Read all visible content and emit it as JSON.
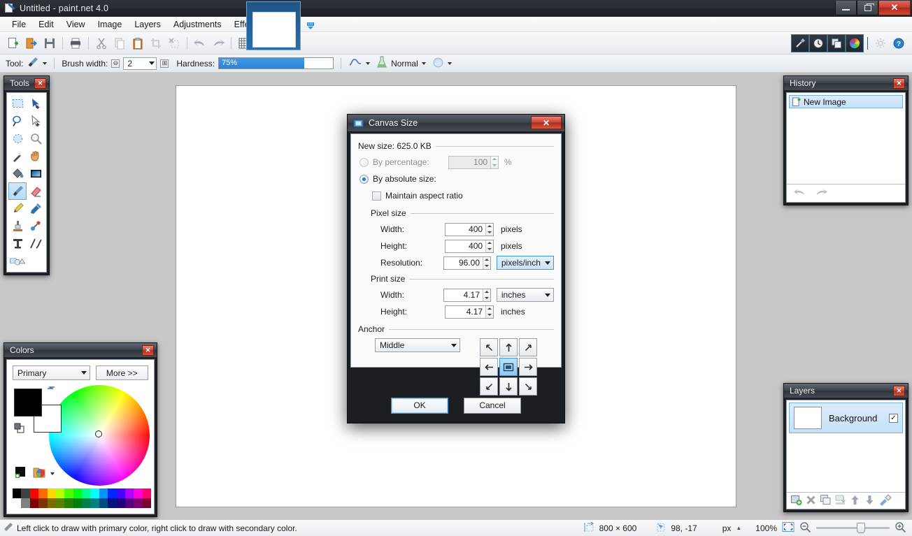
{
  "window": {
    "title": "Untitled - paint.net 4.0",
    "icon": "paintnet-icon",
    "minimize_label": "",
    "maximize_label": "",
    "close_label": "✕"
  },
  "menubar": {
    "items": [
      {
        "label": "File"
      },
      {
        "label": "Edit"
      },
      {
        "label": "View"
      },
      {
        "label": "Image"
      },
      {
        "label": "Layers"
      },
      {
        "label": "Adjustments"
      },
      {
        "label": "Effects"
      }
    ]
  },
  "toolbar": {
    "buttons": [
      {
        "name": "new-icon"
      },
      {
        "name": "open-icon"
      },
      {
        "name": "save-icon"
      },
      {
        "name": "print-icon"
      },
      {
        "name": "cut-icon"
      },
      {
        "name": "copy-icon"
      },
      {
        "name": "paste-icon"
      },
      {
        "name": "crop-to-selection-icon"
      },
      {
        "name": "deselect-icon"
      },
      {
        "name": "undo-icon"
      },
      {
        "name": "redo-icon"
      },
      {
        "name": "grid-icon"
      },
      {
        "name": "rulers-icon"
      }
    ],
    "right_buttons": [
      {
        "name": "tools-window-icon"
      },
      {
        "name": "history-window-icon"
      },
      {
        "name": "layers-window-icon"
      },
      {
        "name": "colors-window-icon"
      },
      {
        "name": "settings-icon"
      },
      {
        "name": "help-icon"
      }
    ]
  },
  "options_bar": {
    "tool_label": "Tool:",
    "tool_icon": "paintbrush-icon",
    "brush_width_label": "Brush width:",
    "brush_width_value": "2",
    "decrease_label": "⊖",
    "increase_label": "⊞",
    "hardness_label": "Hardness:",
    "hardness_value": "75%",
    "hardness_percent": 75,
    "antialias_icon": "antialiasing-icon",
    "blend_icon": "blend-mode-icon",
    "blend_label": "Normal",
    "sampling_icon": "sampling-icon"
  },
  "tools_panel": {
    "title": "Tools",
    "close_label": "✕",
    "tools": [
      {
        "name": "rectangle-select-tool"
      },
      {
        "name": "move-selected-tool"
      },
      {
        "name": "lasso-select-tool"
      },
      {
        "name": "move-selection-tool"
      },
      {
        "name": "ellipse-select-tool"
      },
      {
        "name": "zoom-tool"
      },
      {
        "name": "magic-wand-tool"
      },
      {
        "name": "pan-tool"
      },
      {
        "name": "paint-bucket-tool"
      },
      {
        "name": "gradient-tool"
      },
      {
        "name": "paintbrush-tool"
      },
      {
        "name": "eraser-tool"
      },
      {
        "name": "pencil-tool"
      },
      {
        "name": "color-picker-tool"
      },
      {
        "name": "clone-stamp-tool"
      },
      {
        "name": "recolor-tool"
      },
      {
        "name": "text-tool"
      },
      {
        "name": "line-curve-tool"
      },
      {
        "name": "shapes-tool"
      }
    ],
    "selected_index": 10
  },
  "colors_panel": {
    "title": "Colors",
    "close_label": "✕",
    "mode_label": "Primary",
    "more_label": "More >>",
    "primary_color": "#000000",
    "secondary_color": "#ffffff",
    "swap_icon": "swap-colors-icon",
    "reset_icon": "reset-colors-icon",
    "add_color_icon": "add-to-palette-icon",
    "palette_icon": "palette-icon",
    "palette_row1": [
      "#000000",
      "#404040",
      "#ff0000",
      "#ff6a00",
      "#ffd800",
      "#b6ff00",
      "#4cff00",
      "#00ff21",
      "#00ff90",
      "#00ffff",
      "#0094ff",
      "#0026ff",
      "#4800ff",
      "#b200ff",
      "#ff00dc",
      "#ff006e"
    ],
    "palette_row2": [
      "#ffffff",
      "#808080",
      "#7f0000",
      "#7f3300",
      "#7f6a00",
      "#5b7f00",
      "#267f00",
      "#007f0e",
      "#007f46",
      "#007f7f",
      "#004a7f",
      "#00137f",
      "#21007f",
      "#57007f",
      "#7f006e",
      "#7f0037"
    ]
  },
  "history_panel": {
    "title": "History",
    "close_label": "✕",
    "items": [
      {
        "label": "New Image",
        "icon": "new-image-icon"
      }
    ],
    "undo_icon": "undo-arrow-icon",
    "redo_icon": "redo-arrow-icon"
  },
  "layers_panel": {
    "title": "Layers",
    "close_label": "✕",
    "layers": [
      {
        "name": "Background",
        "visible": true,
        "check_glyph": "✓"
      }
    ],
    "buttons": [
      {
        "name": "add-layer-icon"
      },
      {
        "name": "delete-layer-icon"
      },
      {
        "name": "duplicate-layer-icon"
      },
      {
        "name": "merge-layer-down-icon"
      },
      {
        "name": "move-layer-up-icon"
      },
      {
        "name": "move-layer-down-icon"
      },
      {
        "name": "layer-properties-icon"
      }
    ]
  },
  "statusbar": {
    "hint_icon": "paintbrush-icon",
    "hint": "Left click to draw with primary color, right click to draw with secondary color.",
    "image_size_icon": "image-size-icon",
    "image_size": "800 × 600",
    "cursor_icon": "cursor-position-icon",
    "cursor_position": "98, -17",
    "unit_label": "px",
    "unit_caret": "▲",
    "zoom_label": "100%",
    "fit_icon": "fit-to-window-icon",
    "zoom_out_icon": "zoom-out-icon",
    "zoom_in_icon": "zoom-in-icon",
    "zoom_percent": 100
  },
  "dialog": {
    "title": "Canvas Size",
    "icon": "canvas-size-icon",
    "close_label": "✕",
    "new_size_label": "New size: 625.0 KB",
    "by_percentage_label": "By percentage:",
    "by_percentage_selected": false,
    "percentage_value": "100",
    "percent_symbol": "%",
    "by_absolute_label": "By absolute size:",
    "by_absolute_selected": true,
    "maintain_aspect_label": "Maintain aspect ratio",
    "maintain_aspect_checked": false,
    "pixel_size_label": "Pixel size",
    "pixel_width_label": "Width:",
    "pixel_width_value": "400",
    "pixel_width_unit": "pixels",
    "pixel_height_label": "Height:",
    "pixel_height_value": "400",
    "pixel_height_unit": "pixels",
    "resolution_label": "Resolution:",
    "resolution_value": "96.00",
    "resolution_unit": "pixels/inch",
    "print_size_label": "Print size",
    "print_width_label": "Width:",
    "print_width_value": "4.17",
    "print_width_unit": "inches",
    "print_height_label": "Height:",
    "print_height_value": "4.17",
    "print_height_unit": "inches",
    "anchor_label": "Anchor",
    "anchor_value": "Middle",
    "anchor_buttons": [
      {
        "name": "anchor-top-left",
        "glyph": "↖"
      },
      {
        "name": "anchor-top-center",
        "glyph": "↑"
      },
      {
        "name": "anchor-top-right",
        "glyph": "↗"
      },
      {
        "name": "anchor-middle-left",
        "glyph": "←"
      },
      {
        "name": "anchor-middle-center",
        "glyph": "▣"
      },
      {
        "name": "anchor-middle-right",
        "glyph": "→"
      },
      {
        "name": "anchor-bottom-left",
        "glyph": "↙"
      },
      {
        "name": "anchor-bottom-center",
        "glyph": "↓"
      },
      {
        "name": "anchor-bottom-right",
        "glyph": "↘"
      }
    ],
    "anchor_selected_index": 4,
    "ok_label": "OK",
    "cancel_label": "Cancel"
  },
  "colors": {
    "accent": "#2a84d8",
    "selection": "#c6e0f7",
    "canvas_bg": "#c8c8c8",
    "panel_chrome": "#1e2227",
    "close_red": "#c8432f"
  }
}
